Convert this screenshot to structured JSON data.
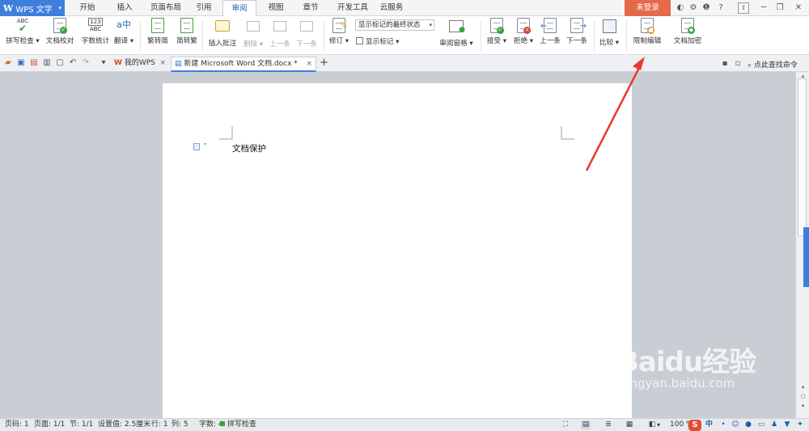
{
  "app": {
    "logo": "W",
    "name": "WPS 文字",
    "caret": "▾"
  },
  "menu_tabs": [
    "开始",
    "插入",
    "页面布局",
    "引用",
    "审阅",
    "视图",
    "章节",
    "开发工具",
    "云服务"
  ],
  "active_tab": "审阅",
  "login_label": "未登录",
  "title_icons": {
    "skin": "◐",
    "settings": "⚙",
    "info": "❶",
    "help": "?",
    "minimize": "─",
    "restore": "❐",
    "close": "✕",
    "up": "⇧"
  },
  "ribbon": {
    "spellcheck": "拼写检查",
    "proofread": "文档校对",
    "word_count": "字数统计",
    "translate": "翻译",
    "trad_to_simp": "繁转简",
    "simp_to_trad": "简转繁",
    "insert_comment": "插入批注",
    "delete": "删除",
    "prev": "上一条",
    "next": "下一条",
    "revision": "修订",
    "markup_state": "显示标记的最终状态",
    "show_markup": "显示标记",
    "review_pane": "审阅窗格",
    "accept": "接受",
    "reject": "拒绝",
    "prev_change": "上一条",
    "next_change": "下一条",
    "compare": "比较",
    "restrict_editing": "限制编辑",
    "doc_encrypt": "文档加密",
    "abc_text": "ABC",
    "count_text": "123",
    "translate_text": "a中"
  },
  "doc_tabs": {
    "my_wps": "我的WPS",
    "current": "新建 Microsoft Word 文档.docx *",
    "close": "×",
    "add": "+"
  },
  "search_cmd": "点此查找命令",
  "document": {
    "text": "文档保护"
  },
  "status": {
    "page_code": "页码: 1",
    "pages": "页面: 1/1",
    "section": "节: 1/1",
    "setting": "设置值: 2.5厘米",
    "row": "行: 1",
    "col": "列: 5",
    "chars": "字数: 4",
    "spell": "拼写检查",
    "zoom": "100 %",
    "ime": "中"
  },
  "watermark": {
    "big": "Baidu经验",
    "small": "jingyan.baidu.com"
  },
  "colors": {
    "accent": "#3f7fdc",
    "login": "#e46a4a",
    "arrow": "#e8392e"
  }
}
